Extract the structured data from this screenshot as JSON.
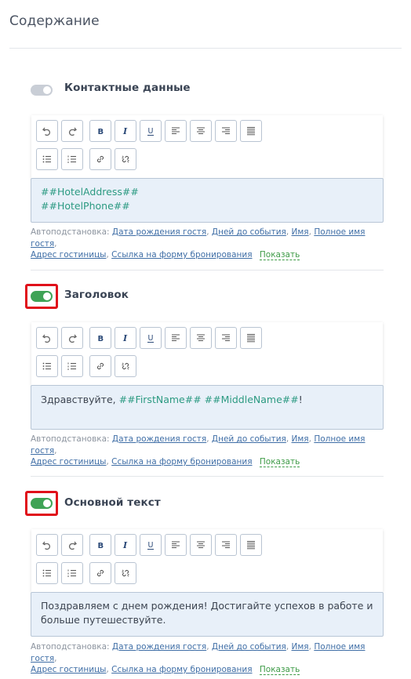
{
  "page": {
    "title": "Содержание"
  },
  "sections": [
    {
      "title": "Контактные данные",
      "enabled": false,
      "content": [
        [
          "##HotelAddress##"
        ],
        [
          "##HotelPhone##"
        ]
      ]
    },
    {
      "title": "Заголовок",
      "enabled": true,
      "content_text": "Здравствуйте, ",
      "content_var1": "##FirstName##",
      "content_space": " ",
      "content_var2": "##MiddleName##",
      "content_end": "!"
    },
    {
      "title": "Основной текст",
      "enabled": true,
      "content_line1": "Поздравляем с днем рождения! Достигайте успехов в работе и",
      "content_line2": "больше путешествуйте."
    }
  ],
  "hint": {
    "prefix": "Автоподстановка:",
    "links": [
      "Дата рождения гостя",
      "Дней до события",
      "Имя",
      "Полное имя гостя",
      "Адрес гостиницы",
      "Ссылка на форму бронирования"
    ],
    "show_label": "Показать"
  },
  "toolbar_icons": [
    "undo-icon",
    "redo-icon",
    "bold-icon",
    "italic-icon",
    "underline-icon",
    "align-left-icon",
    "align-center-icon",
    "align-right-icon",
    "align-justify-icon",
    "bullet-list-icon",
    "numbered-list-icon",
    "link-icon",
    "unlink-icon"
  ],
  "colors": {
    "toggle_on": "#3fa356",
    "toggle_off": "#c9ced6",
    "variable": "#2c9a82",
    "link": "#3f6ea6",
    "show_link": "#3e9b47",
    "highlight": "#e0101a"
  }
}
